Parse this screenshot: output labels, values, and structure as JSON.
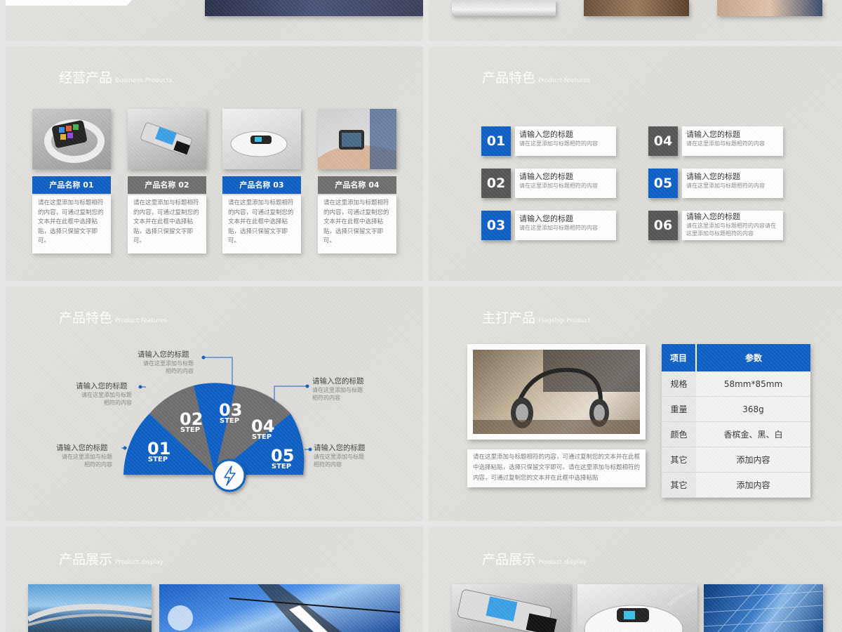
{
  "slides": {
    "business": {
      "title": "经营产品",
      "subtitle": "Business Products",
      "cards": [
        {
          "label": "产品名称 01",
          "color": "#0d5fc4",
          "body": "请在这里添加与标题相符的内容，可通过复制您的文本并在此框中选择粘贴，选择只保留文字即可。"
        },
        {
          "label": "产品名称 02",
          "color": "#6e6e6e",
          "body": "请在这里添加与标题相符的内容，可通过复制您的文本并在此框中选择粘贴，选择只保留文字即可。"
        },
        {
          "label": "产品名称 03",
          "color": "#0d5fc4",
          "body": "请在这里添加与标题相符的内容，可通过复制您的文本并在此框中选择粘贴，选择只保留文字即可。"
        },
        {
          "label": "产品名称 04",
          "color": "#6e6e6e",
          "body": "请在这里添加与标题相符的内容，可通过复制您的文本并在此框中选择粘贴，选择只保留文字即可。"
        }
      ]
    },
    "features_list": {
      "title": "产品特色",
      "subtitle": "Product features",
      "items": [
        {
          "num": "01",
          "title": "请输入您的标题",
          "desc": "请在这里添加与标题相符的内容"
        },
        {
          "num": "02",
          "title": "请输入您的标题",
          "desc": "请在这里添加与标题相符的内容"
        },
        {
          "num": "03",
          "title": "请输入您的标题",
          "desc": "请在这里添加与标题相符的内容"
        },
        {
          "num": "04",
          "title": "请输入您的标题",
          "desc": "请在这里添加与标题相符的内容"
        },
        {
          "num": "05",
          "title": "请输入您的标题",
          "desc": "请在这里添加与标题相符的内容"
        },
        {
          "num": "06",
          "title": "请输入您的标题",
          "desc": "请在这里添加与标题相符的内容请在这里添加与标题相符的内容"
        }
      ]
    },
    "features_steps": {
      "title": "产品特色",
      "subtitle": "Product features",
      "steps": [
        {
          "num": "01",
          "word": "STEP",
          "title": "请输入您的标题",
          "desc1": "请在这里添加与标题",
          "desc2": "相符的内容"
        },
        {
          "num": "02",
          "word": "STEP",
          "title": "请输入您的标题",
          "desc1": "请在这里添加与标题",
          "desc2": "相符的内容"
        },
        {
          "num": "03",
          "word": "STEP",
          "title": "请输入您的标题",
          "desc1": "请在这里添加与标题",
          "desc2": "相符的内容"
        },
        {
          "num": "04",
          "word": "STEP",
          "title": "请输入您的标题",
          "desc1": "请在这里添加与标题",
          "desc2": "相符的内容"
        },
        {
          "num": "05",
          "word": "STEP",
          "title": "请输入您的标题",
          "desc1": "请在这里添加与标题",
          "desc2": "相符的内容"
        }
      ]
    },
    "flagship": {
      "title": "主打产品",
      "subtitle": "Flagship Product",
      "caption": "请在这里添加与标题相符的内容，可通过复制您的文本并在此框中选择粘贴，选择只保留文字即可。请在这里添加与标题相符的内容，可通过复制您的文本并在此框中选择粘贴",
      "table": {
        "headers": [
          "项目",
          "参数"
        ],
        "rows": [
          [
            "规格",
            "58mm*85mm"
          ],
          [
            "重量",
            "368g"
          ],
          [
            "颜色",
            "香槟金、黑、白"
          ],
          [
            "其它",
            "添加内容"
          ],
          [
            "其它",
            "添加内容"
          ]
        ]
      }
    },
    "display_left": {
      "title": "产品展示",
      "subtitle": "Product display"
    },
    "display_right": {
      "title": "产品展示",
      "subtitle": "Product display"
    }
  },
  "colors": {
    "accent": "#0d5fc4",
    "gray": "#6e6e6e",
    "dark_gray": "#555555"
  }
}
